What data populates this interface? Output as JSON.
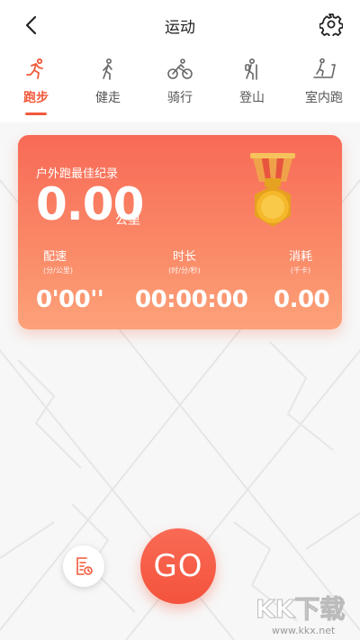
{
  "header": {
    "title": "运动"
  },
  "tabs": [
    {
      "label": "跑步",
      "icon": "running-icon",
      "active": true
    },
    {
      "label": "健走",
      "icon": "walking-icon",
      "active": false
    },
    {
      "label": "骑行",
      "icon": "cycling-icon",
      "active": false
    },
    {
      "label": "登山",
      "icon": "hiking-icon",
      "active": false
    },
    {
      "label": "室内跑",
      "icon": "treadmill-icon",
      "active": false
    }
  ],
  "record": {
    "title": "户外跑最佳纪录",
    "value": "0.00",
    "unit": "公里",
    "stats": {
      "pace": {
        "label": "配速",
        "unit": "(分/公里)",
        "value": "0'00''"
      },
      "duration": {
        "label": "时长",
        "unit": "(时/分/秒)",
        "value": "00:00:00"
      },
      "calories": {
        "label": "消耗",
        "unit": "(千卡)",
        "value": "0.00"
      }
    }
  },
  "controls": {
    "go_label": "GO"
  },
  "watermark": {
    "text": "KK下载",
    "url": "www.kkx.net"
  },
  "colors": {
    "accent": "#f2593a",
    "card_top": "#f86a57",
    "card_bottom": "#fca27a",
    "medal_gold": "#f5b82a"
  }
}
